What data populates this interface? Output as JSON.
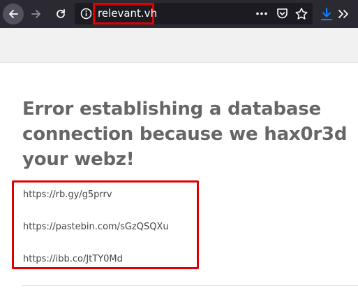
{
  "browser": {
    "url": "relevant.vh",
    "icons": {
      "back": "back-arrow-icon",
      "forward": "forward-arrow-icon",
      "reload": "reload-icon",
      "info": "info-icon",
      "more": "more-actions-icon",
      "pocket": "pocket-icon",
      "bookmark": "star-icon",
      "download": "download-icon",
      "overflow": "overflow-chevron-icon"
    },
    "colors": {
      "toolbar": "#2b2a33",
      "urlbar": "#1c1b22",
      "download_accent": "#0a84ff",
      "highlight": "#e00000"
    }
  },
  "page": {
    "heading": "Error establishing a database connection because we hax0r3d your webz!",
    "links": [
      "https://rb.gy/g5prrv",
      "https://pastebin.com/sGzQSQXu",
      "https://ibb.co/JtTY0Md"
    ]
  }
}
